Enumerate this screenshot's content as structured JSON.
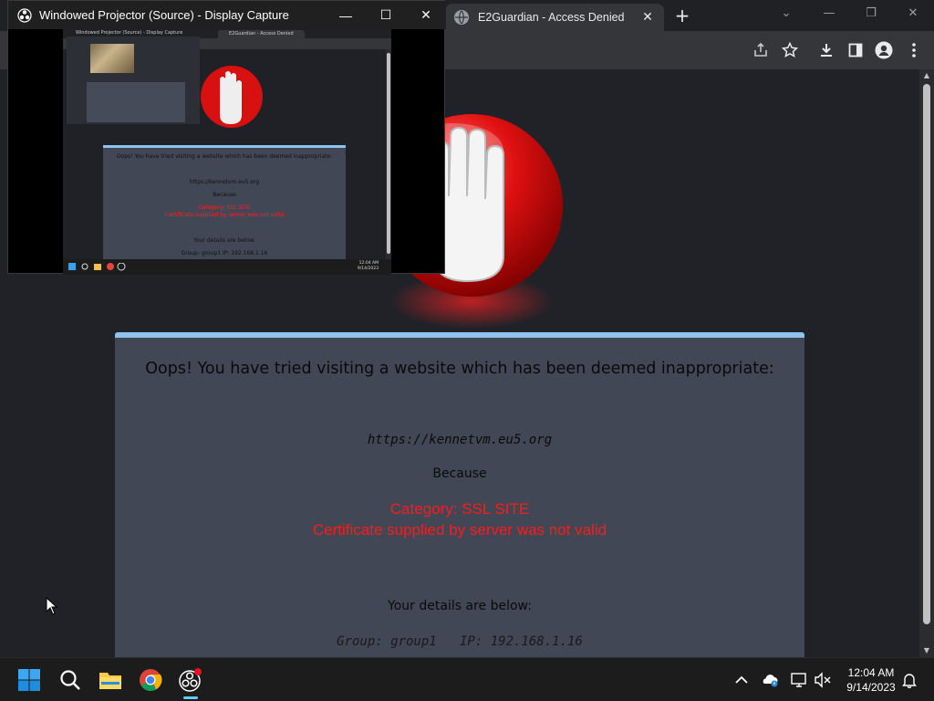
{
  "browser": {
    "active_tab": {
      "title": "E2Guardian - Access Denied"
    },
    "new_tab_label": "+"
  },
  "projector": {
    "title": "Windowed Projector (Source) - Display Capture",
    "mini": {
      "title": "Windowed Projector (Source) - Display Capture",
      "tab": "E2Guardian - Access Denied",
      "headline": "Oops! You have tried visiting a website which has been deemed inappropriate:",
      "url": "https://kennetvm.eu5.org",
      "because": "Because",
      "reason1": "Category: SSL SITE",
      "reason2": "Certificate supplied by server was not valid",
      "details": "Your details are below:",
      "group_line": "Group: group1  IP: 192.168.1.16",
      "clock_time": "12:04 AM",
      "clock_date": "9/14/2023"
    }
  },
  "denied": {
    "headline": "Oops! You have tried visiting a website which has been deemed inappropriate:",
    "url": "https://kennetvm.eu5.org",
    "because": "Because",
    "reason_category": "Category: SSL SITE",
    "reason_detail": "Certificate supplied by server was not valid",
    "details_heading": "Your details are below:",
    "group_line": "Group: group1   IP: 192.168.1.16"
  },
  "taskbar": {
    "clock_time": "12:04 AM",
    "clock_date": "9/14/2023",
    "apps": [
      "start-icon",
      "search-icon",
      "file-explorer-icon",
      "chrome-icon",
      "obs-icon"
    ]
  },
  "colors": {
    "accent_blue": "#8ec3f0",
    "error_red": "#ff1a1a",
    "panel_bg": "#414755",
    "page_bg": "#202228"
  }
}
